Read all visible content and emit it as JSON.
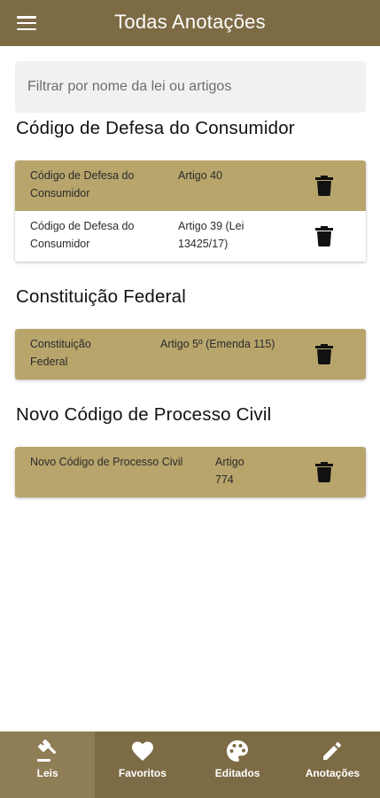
{
  "appbar": {
    "title": "Todas Anotações",
    "menu_icon": "menu-icon"
  },
  "filter": {
    "placeholder": "Filtrar por nome da lei ou artigos",
    "value": ""
  },
  "sections": [
    {
      "title": "Código de Defesa do Consumidor",
      "rows": [
        {
          "law": "Código de Defesa do Consumidor",
          "article": "Artigo 40"
        },
        {
          "law": "Código de Defesa do Consumidor",
          "article": "Artigo 39 (Lei 13425/17)"
        }
      ]
    },
    {
      "title": "Constituição Federal",
      "rows": [
        {
          "law": "Constituição Federal",
          "article": "Artigo 5º (Emenda 115)"
        }
      ]
    },
    {
      "title": "Novo Código de Processo Civil",
      "rows": [
        {
          "law": "Novo Código de Processo Civil",
          "article": "Artigo 774"
        }
      ]
    }
  ],
  "tabs": [
    {
      "label": "Leis",
      "icon": "gavel-icon"
    },
    {
      "label": "Favoritos",
      "icon": "heart-icon"
    },
    {
      "label": "Editados",
      "icon": "palette-icon"
    },
    {
      "label": "Anotações",
      "icon": "pencil-icon"
    }
  ],
  "colors": {
    "primary": "#7d6b45",
    "row_gold": "#b8a56c",
    "tab_active": "#8f7d55"
  }
}
